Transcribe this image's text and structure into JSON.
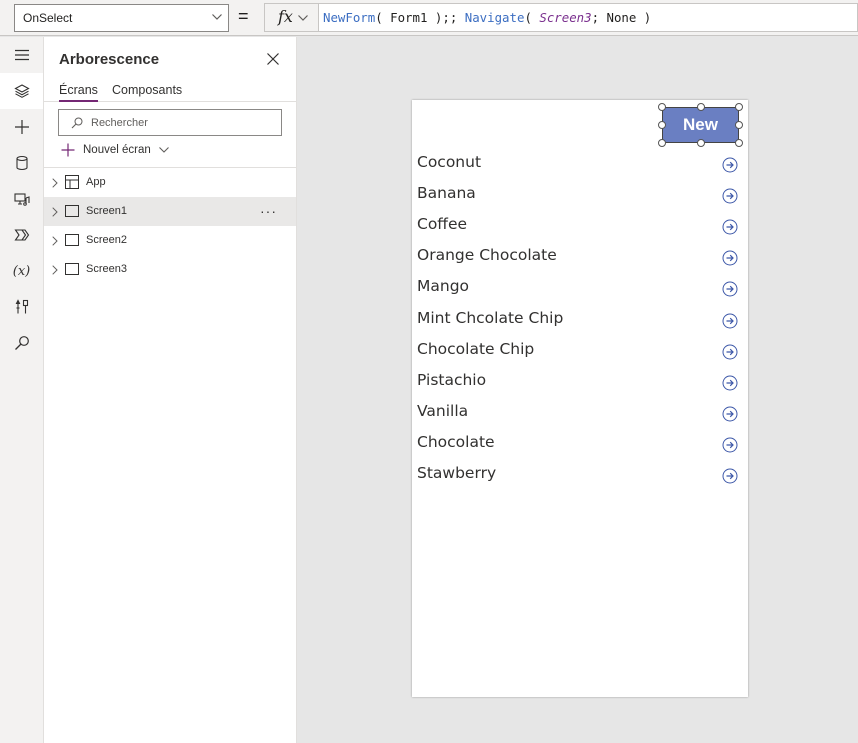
{
  "formula_bar": {
    "property": "OnSelect",
    "equals": "=",
    "fx_label": "fx",
    "formula_parts": {
      "fn1": "NewForm",
      "p1": "( Form1 );; ",
      "fn2": "Navigate",
      "p2": "( ",
      "screen": "Screen3",
      "p3": "; None )"
    }
  },
  "rail": {
    "items": [
      "hamburger-icon",
      "layers-icon",
      "plus-icon",
      "database-icon",
      "media-icon",
      "power-automate-icon",
      "variables-icon",
      "tools-icon",
      "search-icon"
    ],
    "variables_label": "(x)"
  },
  "tree": {
    "title": "Arborescence",
    "tabs": [
      "Écrans",
      "Composants"
    ],
    "search_placeholder": "Rechercher",
    "new_screen_label": "Nouvel écran",
    "nodes": [
      {
        "label": "App",
        "icon": "app-icon",
        "selected": false
      },
      {
        "label": "Screen1",
        "icon": "screen-icon",
        "selected": true,
        "more": "···"
      },
      {
        "label": "Screen2",
        "icon": "screen-icon",
        "selected": false
      },
      {
        "label": "Screen3",
        "icon": "screen-icon",
        "selected": false
      }
    ]
  },
  "app": {
    "new_button": "New",
    "gallery_items": [
      "Coconut",
      "Banana",
      "Coffee",
      "Orange Chocolate",
      "Mango",
      "Mint Chcolate Chip",
      "Chocolate Chip",
      "Pistachio",
      "Vanilla",
      "Chocolate",
      "Stawberry"
    ],
    "colors": {
      "accent": "#742774",
      "button": "#6a7fc2",
      "arrow": "#3c57a8"
    }
  }
}
